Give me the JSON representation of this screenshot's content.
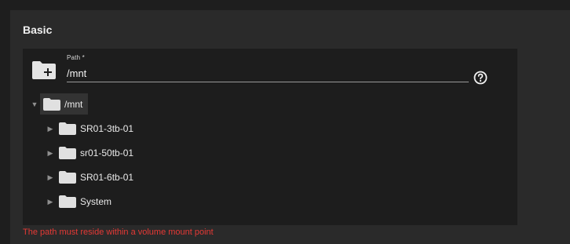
{
  "section": {
    "title": "Basic"
  },
  "path_field": {
    "label": "Path *",
    "value": "/mnt"
  },
  "tree": {
    "root": {
      "label": "/mnt",
      "expanded": true
    },
    "children": [
      {
        "label": "SR01-3tb-01"
      },
      {
        "label": "sr01-50tb-01"
      },
      {
        "label": "SR01-6tb-01"
      },
      {
        "label": "System"
      }
    ]
  },
  "validation": {
    "error": "The path must reside within a volume mount point"
  },
  "icons": {
    "add_folder": "create-folder-icon",
    "help": "help-circle-icon",
    "folder": "folder-icon",
    "expand": "caret-right-icon",
    "collapse": "caret-down-icon"
  },
  "colors": {
    "background": "#1e1e1e",
    "card": "#2a2a2a",
    "explorer": "#1d1d1d",
    "error": "#e53935",
    "folder": "#e0e0e0"
  }
}
